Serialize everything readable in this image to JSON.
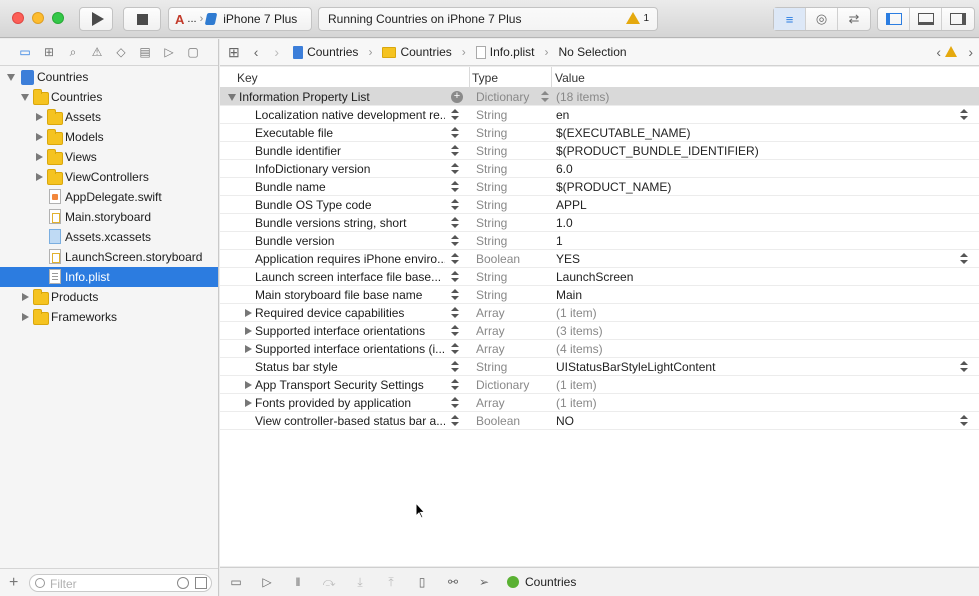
{
  "toolbar": {
    "scheme_device": "iPhone 7 Plus",
    "scheme_ellipsis": "...",
    "activity_text": "Running Countries on iPhone 7 Plus",
    "warning_count": "1"
  },
  "navigator": {
    "items": [
      {
        "label": "Countries",
        "kind": "project",
        "level": 0,
        "disclosure": "open"
      },
      {
        "label": "Countries",
        "kind": "folder",
        "level": 1,
        "disclosure": "open"
      },
      {
        "label": "Assets",
        "kind": "folder",
        "level": 2,
        "disclosure": "closed"
      },
      {
        "label": "Models",
        "kind": "folder",
        "level": 2,
        "disclosure": "closed"
      },
      {
        "label": "Views",
        "kind": "folder",
        "level": 2,
        "disclosure": "closed"
      },
      {
        "label": "ViewControllers",
        "kind": "folder",
        "level": 2,
        "disclosure": "closed"
      },
      {
        "label": "AppDelegate.swift",
        "kind": "swift",
        "level": 2,
        "disclosure": "none"
      },
      {
        "label": "Main.storyboard",
        "kind": "story",
        "level": 2,
        "disclosure": "none"
      },
      {
        "label": "Assets.xcassets",
        "kind": "xcassets",
        "level": 2,
        "disclosure": "none"
      },
      {
        "label": "LaunchScreen.storyboard",
        "kind": "story",
        "level": 2,
        "disclosure": "none"
      },
      {
        "label": "Info.plist",
        "kind": "plist",
        "level": 2,
        "disclosure": "none",
        "selected": true
      },
      {
        "label": "Products",
        "kind": "folder",
        "level": 1,
        "disclosure": "closed"
      },
      {
        "label": "Frameworks",
        "kind": "folder",
        "level": 1,
        "disclosure": "closed"
      }
    ],
    "filter_placeholder": "Filter"
  },
  "jumpbar": {
    "crumbs": [
      "Countries",
      "Countries",
      "Info.plist",
      "No Selection"
    ]
  },
  "editor": {
    "columns": {
      "key": "Key",
      "type": "Type",
      "value": "Value"
    },
    "rows": [
      {
        "key": "Information Property List",
        "type": "Dictionary",
        "value": "(18 items)",
        "root": true,
        "value_dim": true
      },
      {
        "key": "Localization native development re...",
        "type": "String",
        "value": "en",
        "value_popup": true
      },
      {
        "key": "Executable file",
        "type": "String",
        "value": "$(EXECUTABLE_NAME)"
      },
      {
        "key": "Bundle identifier",
        "type": "String",
        "value": "$(PRODUCT_BUNDLE_IDENTIFIER)"
      },
      {
        "key": "InfoDictionary version",
        "type": "String",
        "value": "6.0"
      },
      {
        "key": "Bundle name",
        "type": "String",
        "value": "$(PRODUCT_NAME)"
      },
      {
        "key": "Bundle OS Type code",
        "type": "String",
        "value": "APPL"
      },
      {
        "key": "Bundle versions string, short",
        "type": "String",
        "value": "1.0"
      },
      {
        "key": "Bundle version",
        "type": "String",
        "value": "1"
      },
      {
        "key": "Application requires iPhone enviro...",
        "type": "Boolean",
        "value": "YES",
        "value_popup": true
      },
      {
        "key": "Launch screen interface file base...",
        "type": "String",
        "value": "LaunchScreen"
      },
      {
        "key": "Main storyboard file base name",
        "type": "String",
        "value": "Main"
      },
      {
        "key": "Required device capabilities",
        "type": "Array",
        "value": "(1 item)",
        "collapsible": true,
        "value_dim": true
      },
      {
        "key": "Supported interface orientations",
        "type": "Array",
        "value": "(3 items)",
        "collapsible": true,
        "value_dim": true
      },
      {
        "key": "Supported interface orientations (i...",
        "type": "Array",
        "value": "(4 items)",
        "collapsible": true,
        "value_dim": true
      },
      {
        "key": "Status bar style",
        "type": "String",
        "value": "UIStatusBarStyleLightContent",
        "value_popup": true
      },
      {
        "key": "App Transport Security Settings",
        "type": "Dictionary",
        "value": "(1 item)",
        "collapsible": true,
        "value_dim": true
      },
      {
        "key": "Fonts provided by application",
        "type": "Array",
        "value": "(1 item)",
        "collapsible": true,
        "value_dim": true
      },
      {
        "key": "View controller-based status bar a...",
        "type": "Boolean",
        "value": "NO",
        "value_popup": true
      }
    ]
  },
  "debugbar": {
    "process_name": "Countries"
  },
  "colors": {
    "selection": "#2c7ce0",
    "folder": "#f5c320",
    "warning": "#e5a90e"
  }
}
